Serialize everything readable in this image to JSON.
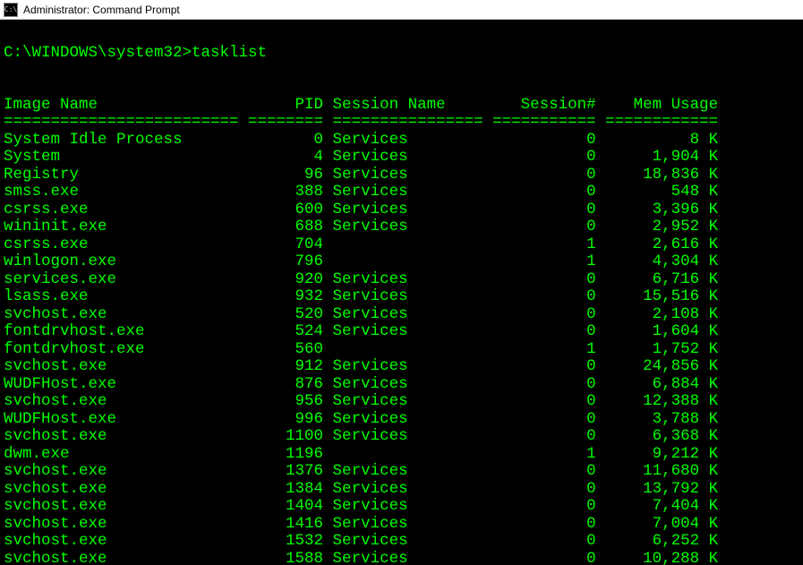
{
  "window": {
    "title": "Administrator: Command Prompt",
    "icon_text": "C:\\"
  },
  "prompt": {
    "path": "C:\\WINDOWS\\system32>",
    "command": "tasklist"
  },
  "headers": {
    "image_name": "Image Name",
    "pid": "PID",
    "session_name": "Session Name",
    "session_num": "Session#",
    "mem_usage": "Mem Usage"
  },
  "processes": [
    {
      "name": "System Idle Process",
      "pid": "0",
      "session": "Services",
      "snum": "0",
      "mem": "8 K"
    },
    {
      "name": "System",
      "pid": "4",
      "session": "Services",
      "snum": "0",
      "mem": "1,904 K"
    },
    {
      "name": "Registry",
      "pid": "96",
      "session": "Services",
      "snum": "0",
      "mem": "18,836 K"
    },
    {
      "name": "smss.exe",
      "pid": "388",
      "session": "Services",
      "snum": "0",
      "mem": "548 K"
    },
    {
      "name": "csrss.exe",
      "pid": "600",
      "session": "Services",
      "snum": "0",
      "mem": "3,396 K"
    },
    {
      "name": "wininit.exe",
      "pid": "688",
      "session": "Services",
      "snum": "0",
      "mem": "2,952 K"
    },
    {
      "name": "csrss.exe",
      "pid": "704",
      "session": "",
      "snum": "1",
      "mem": "2,616 K"
    },
    {
      "name": "winlogon.exe",
      "pid": "796",
      "session": "",
      "snum": "1",
      "mem": "4,304 K"
    },
    {
      "name": "services.exe",
      "pid": "920",
      "session": "Services",
      "snum": "0",
      "mem": "6,716 K"
    },
    {
      "name": "lsass.exe",
      "pid": "932",
      "session": "Services",
      "snum": "0",
      "mem": "15,516 K"
    },
    {
      "name": "svchost.exe",
      "pid": "520",
      "session": "Services",
      "snum": "0",
      "mem": "2,108 K"
    },
    {
      "name": "fontdrvhost.exe",
      "pid": "524",
      "session": "Services",
      "snum": "0",
      "mem": "1,604 K"
    },
    {
      "name": "fontdrvhost.exe",
      "pid": "560",
      "session": "",
      "snum": "1",
      "mem": "1,752 K"
    },
    {
      "name": "svchost.exe",
      "pid": "912",
      "session": "Services",
      "snum": "0",
      "mem": "24,856 K"
    },
    {
      "name": "WUDFHost.exe",
      "pid": "876",
      "session": "Services",
      "snum": "0",
      "mem": "6,884 K"
    },
    {
      "name": "svchost.exe",
      "pid": "956",
      "session": "Services",
      "snum": "0",
      "mem": "12,388 K"
    },
    {
      "name": "WUDFHost.exe",
      "pid": "996",
      "session": "Services",
      "snum": "0",
      "mem": "3,788 K"
    },
    {
      "name": "svchost.exe",
      "pid": "1100",
      "session": "Services",
      "snum": "0",
      "mem": "6,368 K"
    },
    {
      "name": "dwm.exe",
      "pid": "1196",
      "session": "",
      "snum": "1",
      "mem": "9,212 K"
    },
    {
      "name": "svchost.exe",
      "pid": "1376",
      "session": "Services",
      "snum": "0",
      "mem": "11,680 K"
    },
    {
      "name": "svchost.exe",
      "pid": "1384",
      "session": "Services",
      "snum": "0",
      "mem": "13,792 K"
    },
    {
      "name": "svchost.exe",
      "pid": "1404",
      "session": "Services",
      "snum": "0",
      "mem": "7,404 K"
    },
    {
      "name": "svchost.exe",
      "pid": "1416",
      "session": "Services",
      "snum": "0",
      "mem": "7,004 K"
    },
    {
      "name": "svchost.exe",
      "pid": "1532",
      "session": "Services",
      "snum": "0",
      "mem": "6,252 K"
    },
    {
      "name": "svchost.exe",
      "pid": "1588",
      "session": "Services",
      "snum": "0",
      "mem": "10,288 K"
    }
  ],
  "widths": {
    "name": 25,
    "pid": 8,
    "session": 16,
    "snum": 11,
    "mem": 12
  }
}
